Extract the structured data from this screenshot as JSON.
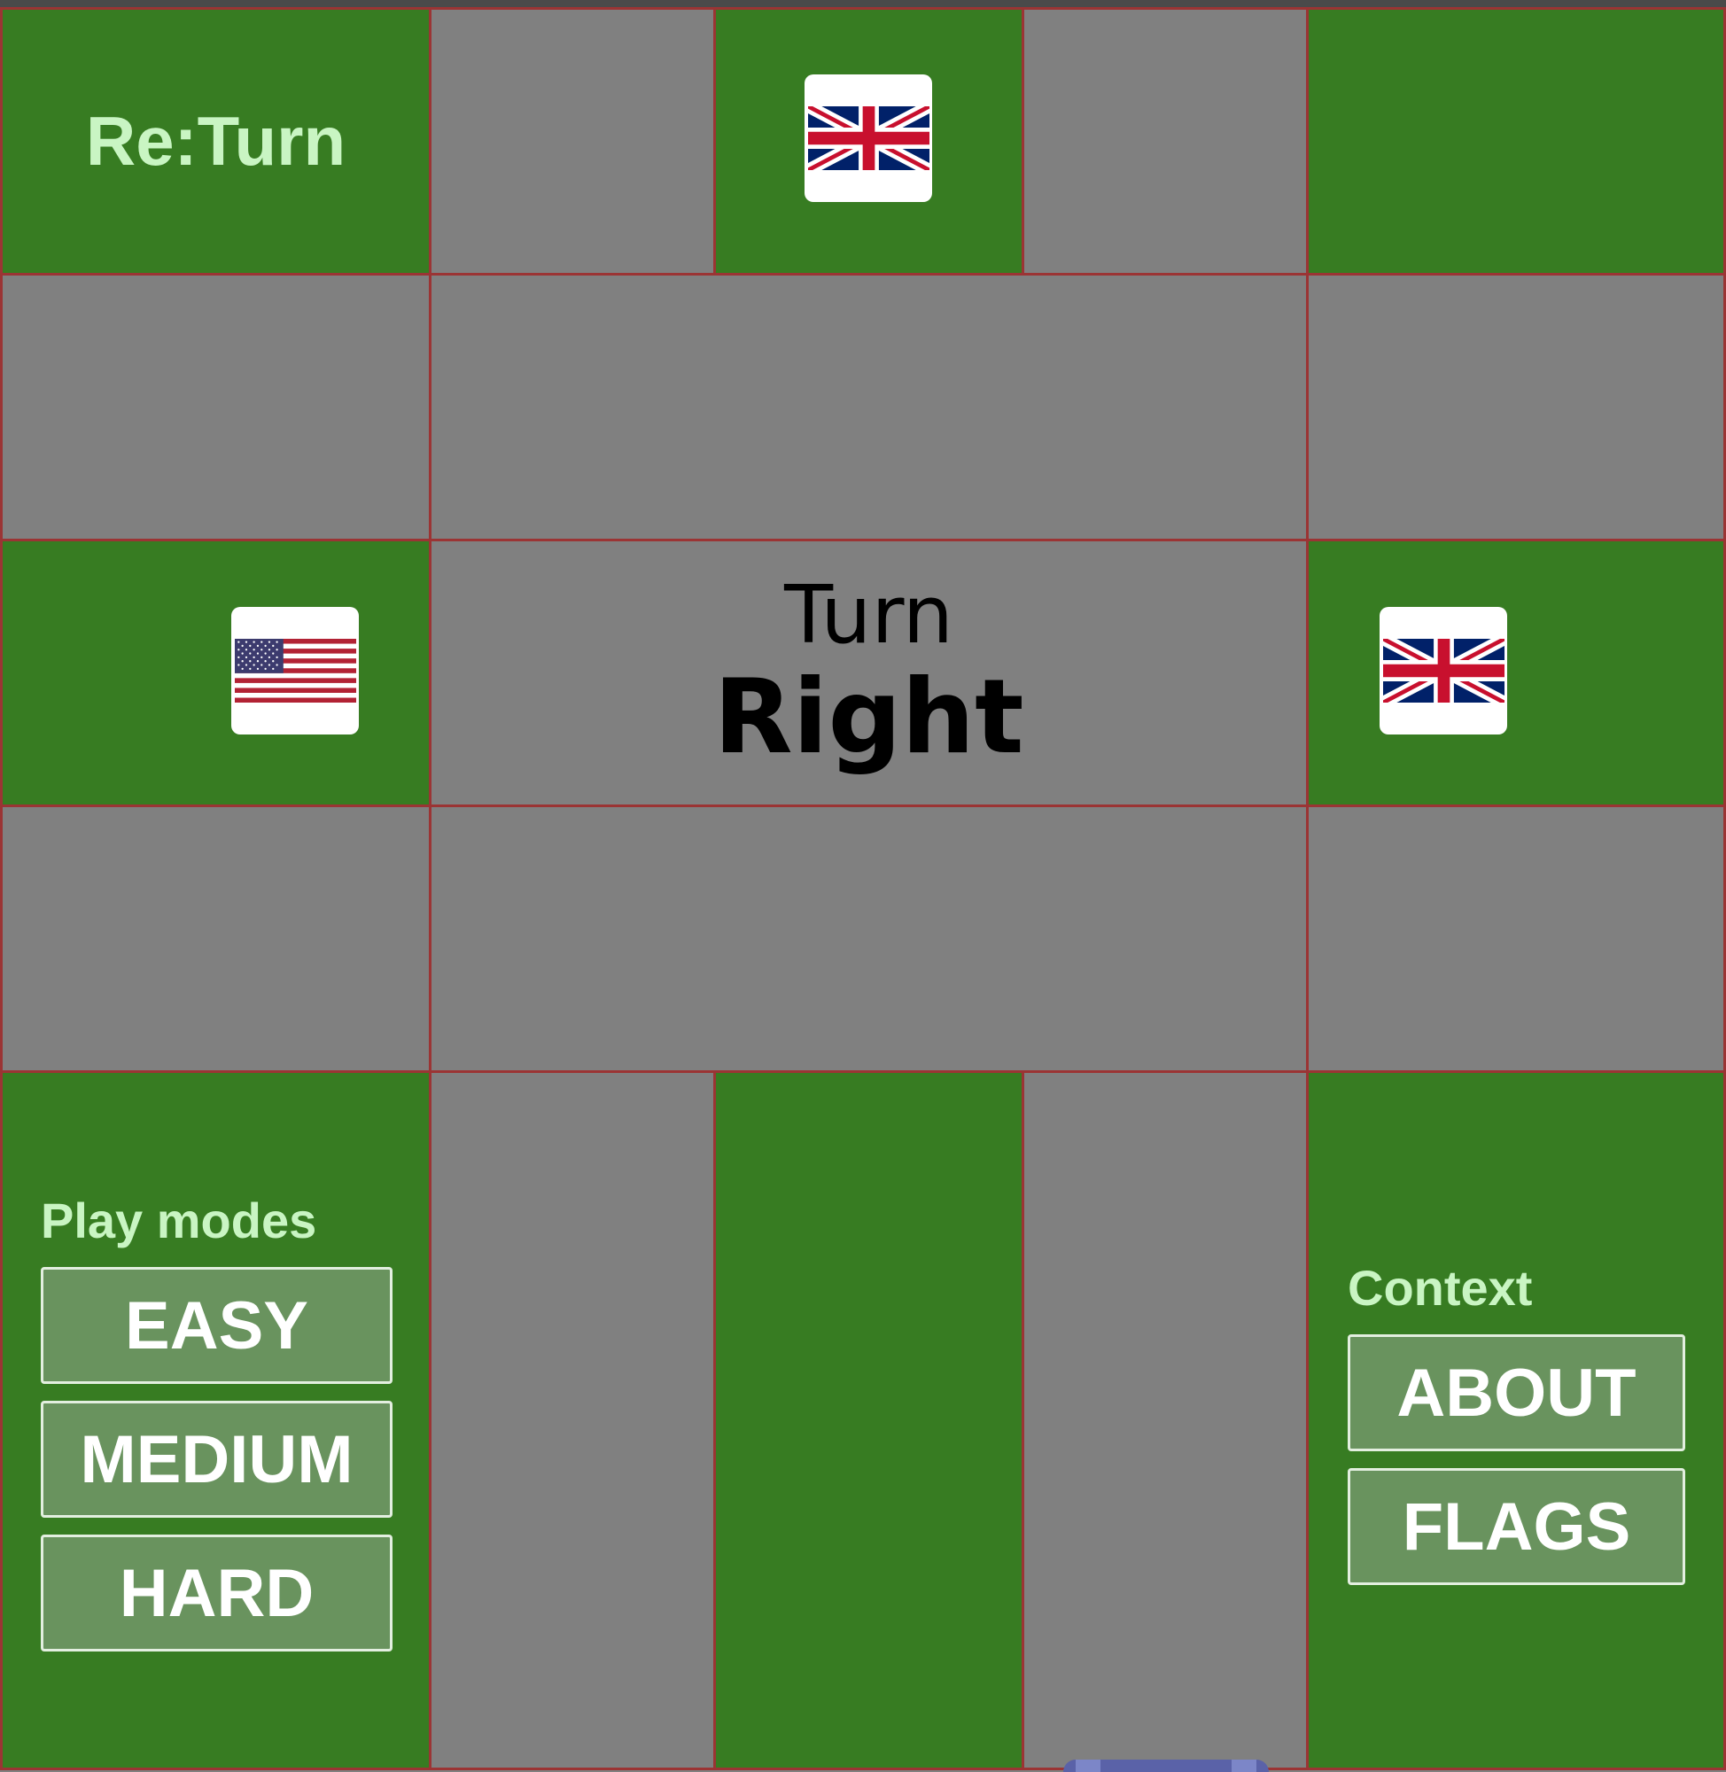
{
  "app": {
    "title": "Re:Turn"
  },
  "board": {
    "prompt_label": "Turn",
    "direction": "Right"
  },
  "flags": {
    "top": "uk-flag-icon",
    "left": "us-flag-icon",
    "right": "uk-flag-icon"
  },
  "play_modes": {
    "heading": "Play modes",
    "buttons": [
      "EASY",
      "MEDIUM",
      "HARD"
    ]
  },
  "context": {
    "heading": "Context",
    "buttons": [
      "ABOUT",
      "FLAGS"
    ]
  },
  "colors": {
    "road_grey": "#808080",
    "grass_green": "#377c22",
    "grid_line": "#9b3434",
    "title_text": "#c9f5c3",
    "button_bg": "#69935e"
  }
}
